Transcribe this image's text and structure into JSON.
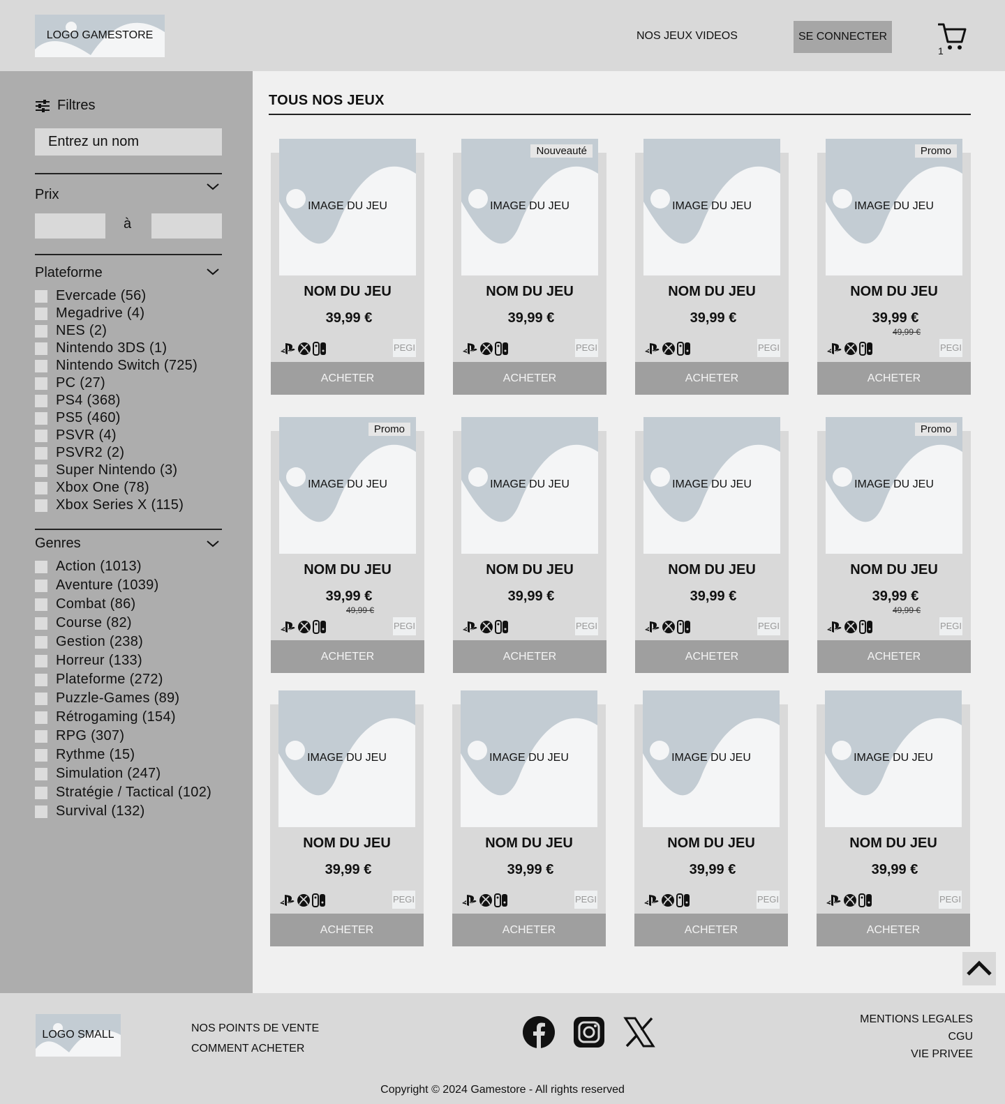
{
  "header": {
    "logo": "LOGO GAMESTORE",
    "nav_games": "NOS JEUX VIDEOS",
    "login": "SE CONNECTER",
    "cart_count": "1"
  },
  "sidebar": {
    "filters_label": "Filtres",
    "search_placeholder": "Entrez un nom",
    "price_title": "Prix",
    "price_separator": "à",
    "platform_title": "Plateforme",
    "platforms": [
      "Evercade (56)",
      "Megadrive (4)",
      "NES (2)",
      "Nintendo 3DS (1)",
      "Nintendo Switch (725)",
      "PC (27)",
      "PS4 (368)",
      "PS5 (460)",
      "PSVR (4)",
      "PSVR2 (2)",
      "Super Nintendo (3)",
      "Xbox One (78)",
      "Xbox Series X (115)"
    ],
    "genres_title": "Genres",
    "genres": [
      "Action (1013)",
      "Aventure (1039)",
      "Combat (86)",
      "Course (82)",
      "Gestion (238)",
      "Horreur (133)",
      "Plateforme (272)",
      "Puzzle-Games (89)",
      "Rétrogaming (154)",
      "RPG (307)",
      "Rythme (15)",
      "Simulation (247)",
      "Stratégie / Tactical (102)",
      "Survival (132)"
    ]
  },
  "main": {
    "title": "TOUS NOS JEUX",
    "cards": [
      {
        "image_label": "IMAGE DU JEU",
        "name": "NOM DU JEU",
        "price": "39,99 €",
        "badge": "",
        "old_price": "",
        "pegi": "PEGI",
        "button": "ACHETER"
      },
      {
        "image_label": "IMAGE DU JEU",
        "name": "NOM DU JEU",
        "price": "39,99 €",
        "badge": "Nouveauté",
        "old_price": "",
        "pegi": "PEGI",
        "button": "ACHETER"
      },
      {
        "image_label": "IMAGE DU JEU",
        "name": "NOM DU JEU",
        "price": "39,99 €",
        "badge": "",
        "old_price": "",
        "pegi": "PEGI",
        "button": "ACHETER"
      },
      {
        "image_label": "IMAGE DU JEU",
        "name": "NOM DU JEU",
        "price": "39,99 €",
        "badge": "Promo",
        "old_price": "49,99 €",
        "pegi": "PEGI",
        "button": "ACHETER"
      },
      {
        "image_label": "IMAGE DU JEU",
        "name": "NOM DU JEU",
        "price": "39,99 €",
        "badge": "Promo",
        "old_price": "49,99 €",
        "pegi": "PEGI",
        "button": "ACHETER"
      },
      {
        "image_label": "IMAGE DU JEU",
        "name": "NOM DU JEU",
        "price": "39,99 €",
        "badge": "",
        "old_price": "",
        "pegi": "PEGI",
        "button": "ACHETER"
      },
      {
        "image_label": "IMAGE DU JEU",
        "name": "NOM DU JEU",
        "price": "39,99 €",
        "badge": "",
        "old_price": "",
        "pegi": "PEGI",
        "button": "ACHETER"
      },
      {
        "image_label": "IMAGE DU JEU",
        "name": "NOM DU JEU",
        "price": "39,99 €",
        "badge": "Promo",
        "old_price": "49,99 €",
        "pegi": "PEGI",
        "button": "ACHETER"
      },
      {
        "image_label": "IMAGE DU JEU",
        "name": "NOM DU JEU",
        "price": "39,99 €",
        "badge": "",
        "old_price": "",
        "pegi": "PEGI",
        "button": "ACHETER"
      },
      {
        "image_label": "IMAGE DU JEU",
        "name": "NOM DU JEU",
        "price": "39,99 €",
        "badge": "",
        "old_price": "",
        "pegi": "PEGI",
        "button": "ACHETER"
      },
      {
        "image_label": "IMAGE DU JEU",
        "name": "NOM DU JEU",
        "price": "39,99 €",
        "badge": "",
        "old_price": "",
        "pegi": "PEGI",
        "button": "ACHETER"
      },
      {
        "image_label": "IMAGE DU JEU",
        "name": "NOM DU JEU",
        "price": "39,99 €",
        "badge": "",
        "old_price": "",
        "pegi": "PEGI",
        "button": "ACHETER"
      }
    ]
  },
  "footer": {
    "logo": "LOGO SMALL",
    "links": [
      "NOS POINTS DE VENTE",
      "COMMENT ACHETER"
    ],
    "legal": [
      "MENTIONS LEGALES",
      "CGU",
      "VIE PRIVEE"
    ],
    "social_icons": [
      "facebook-icon",
      "instagram-icon",
      "x-icon"
    ],
    "copyright": "Copyright © 2024 Gamestore - All rights reserved"
  },
  "colors": {
    "header_bg": "#d9d9d9",
    "sidebar_bg": "#adadad",
    "main_bg": "#f0f0f0",
    "button_bg": "#9f9f9f",
    "placeholder_blue": "#c3ccd3"
  }
}
